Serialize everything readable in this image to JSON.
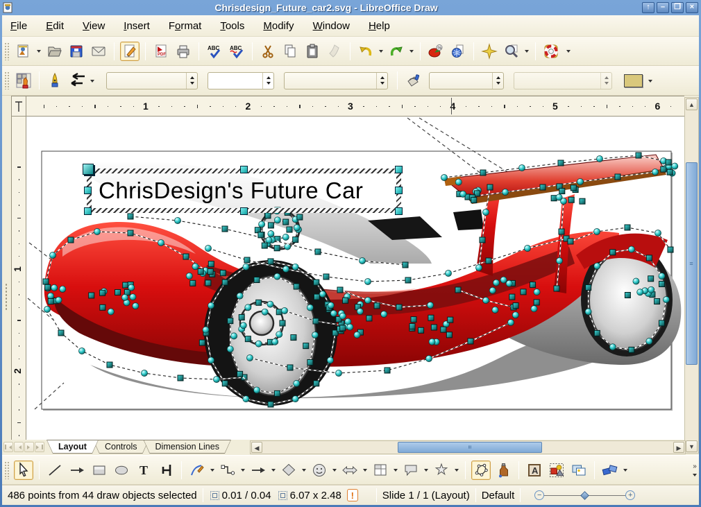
{
  "window": {
    "title": "Chrisdesign_Future_car2.svg - LibreOffice Draw",
    "buttons": {
      "rollup": "↑",
      "minimize": "–",
      "maximize": "❐",
      "close": "×"
    }
  },
  "menu": {
    "items": [
      {
        "label": "File",
        "mnemonic": 0
      },
      {
        "label": "Edit",
        "mnemonic": 0
      },
      {
        "label": "View",
        "mnemonic": 0
      },
      {
        "label": "Insert",
        "mnemonic": 0
      },
      {
        "label": "Format",
        "mnemonic": 1
      },
      {
        "label": "Tools",
        "mnemonic": 0
      },
      {
        "label": "Modify",
        "mnemonic": 0
      },
      {
        "label": "Window",
        "mnemonic": 0
      },
      {
        "label": "Help",
        "mnemonic": 0
      }
    ]
  },
  "toolbar_standard": {
    "icons": [
      "new-document",
      "open",
      "save",
      "email",
      "edit-file",
      "export-pdf",
      "print",
      "spellcheck",
      "auto-spellcheck",
      "cut",
      "copy",
      "paste",
      "format-paintbrush",
      "undo",
      "redo",
      "chart",
      "hyperlink-globe",
      "navigator-star",
      "zoom",
      "help-lifebuoy",
      "toolbar-overflow"
    ],
    "active": "edit-file"
  },
  "toolbar_line_filling": {
    "icons": [
      "edit-points-mode",
      "pen-line",
      "arrow-style",
      "fill-can"
    ],
    "line_style_value": "",
    "line_width_value": "",
    "line_color_value": "",
    "area_style_value": "",
    "area_fill_value": "",
    "color_swatch": "#d9c87c"
  },
  "ruler": {
    "h_numbers": [
      "1",
      "2",
      "3",
      "4",
      "5",
      "6"
    ],
    "v_numbers": [
      "1",
      "2"
    ]
  },
  "canvas": {
    "textbox_text": "ChrisDesign's Future Car",
    "selection_color": "#14b8b8"
  },
  "tabs": {
    "items": [
      {
        "label": "Layout",
        "active": true
      },
      {
        "label": "Controls",
        "active": false
      },
      {
        "label": "Dimension Lines",
        "active": false
      }
    ]
  },
  "toolbar_drawing": {
    "icons": [
      "select",
      "line",
      "line-ends-arrow",
      "rectangle",
      "ellipse",
      "text",
      "vertical-text",
      "curve",
      "connector",
      "lines-arrows",
      "basic-shapes",
      "symbol-shapes",
      "block-arrows",
      "flowchart",
      "callouts",
      "stars",
      "edit-points",
      "glue-points",
      "fontwork",
      "from-file",
      "gallery",
      "rotate"
    ],
    "active": [
      "select",
      "edit-points"
    ]
  },
  "statusbar": {
    "selection": "486 points from 44 draw objects selected",
    "position": "0.01 / 0.04",
    "size": "6.07 x 2.48",
    "warning": "!",
    "slide": "Slide 1 / 1 (Layout)",
    "style": "Default",
    "zoom_minus": "−",
    "zoom_plus": "+"
  }
}
